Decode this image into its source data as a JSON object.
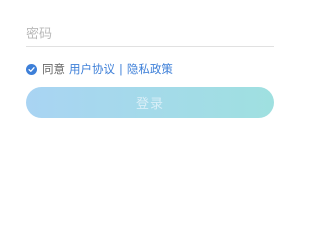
{
  "password": {
    "placeholder": "密码",
    "value": ""
  },
  "agreement": {
    "checked": true,
    "prefix": "同意",
    "user_agreement": "用户协议",
    "separator": "|",
    "privacy_policy": "隐私政策"
  },
  "login_button": {
    "label": "登录"
  },
  "colors": {
    "accent": "#3d7fd8",
    "button_gradient_start": "#a9d4f3",
    "button_gradient_end": "#9fe0e0"
  },
  "icons": {
    "agree_check": "check-circle-icon"
  }
}
